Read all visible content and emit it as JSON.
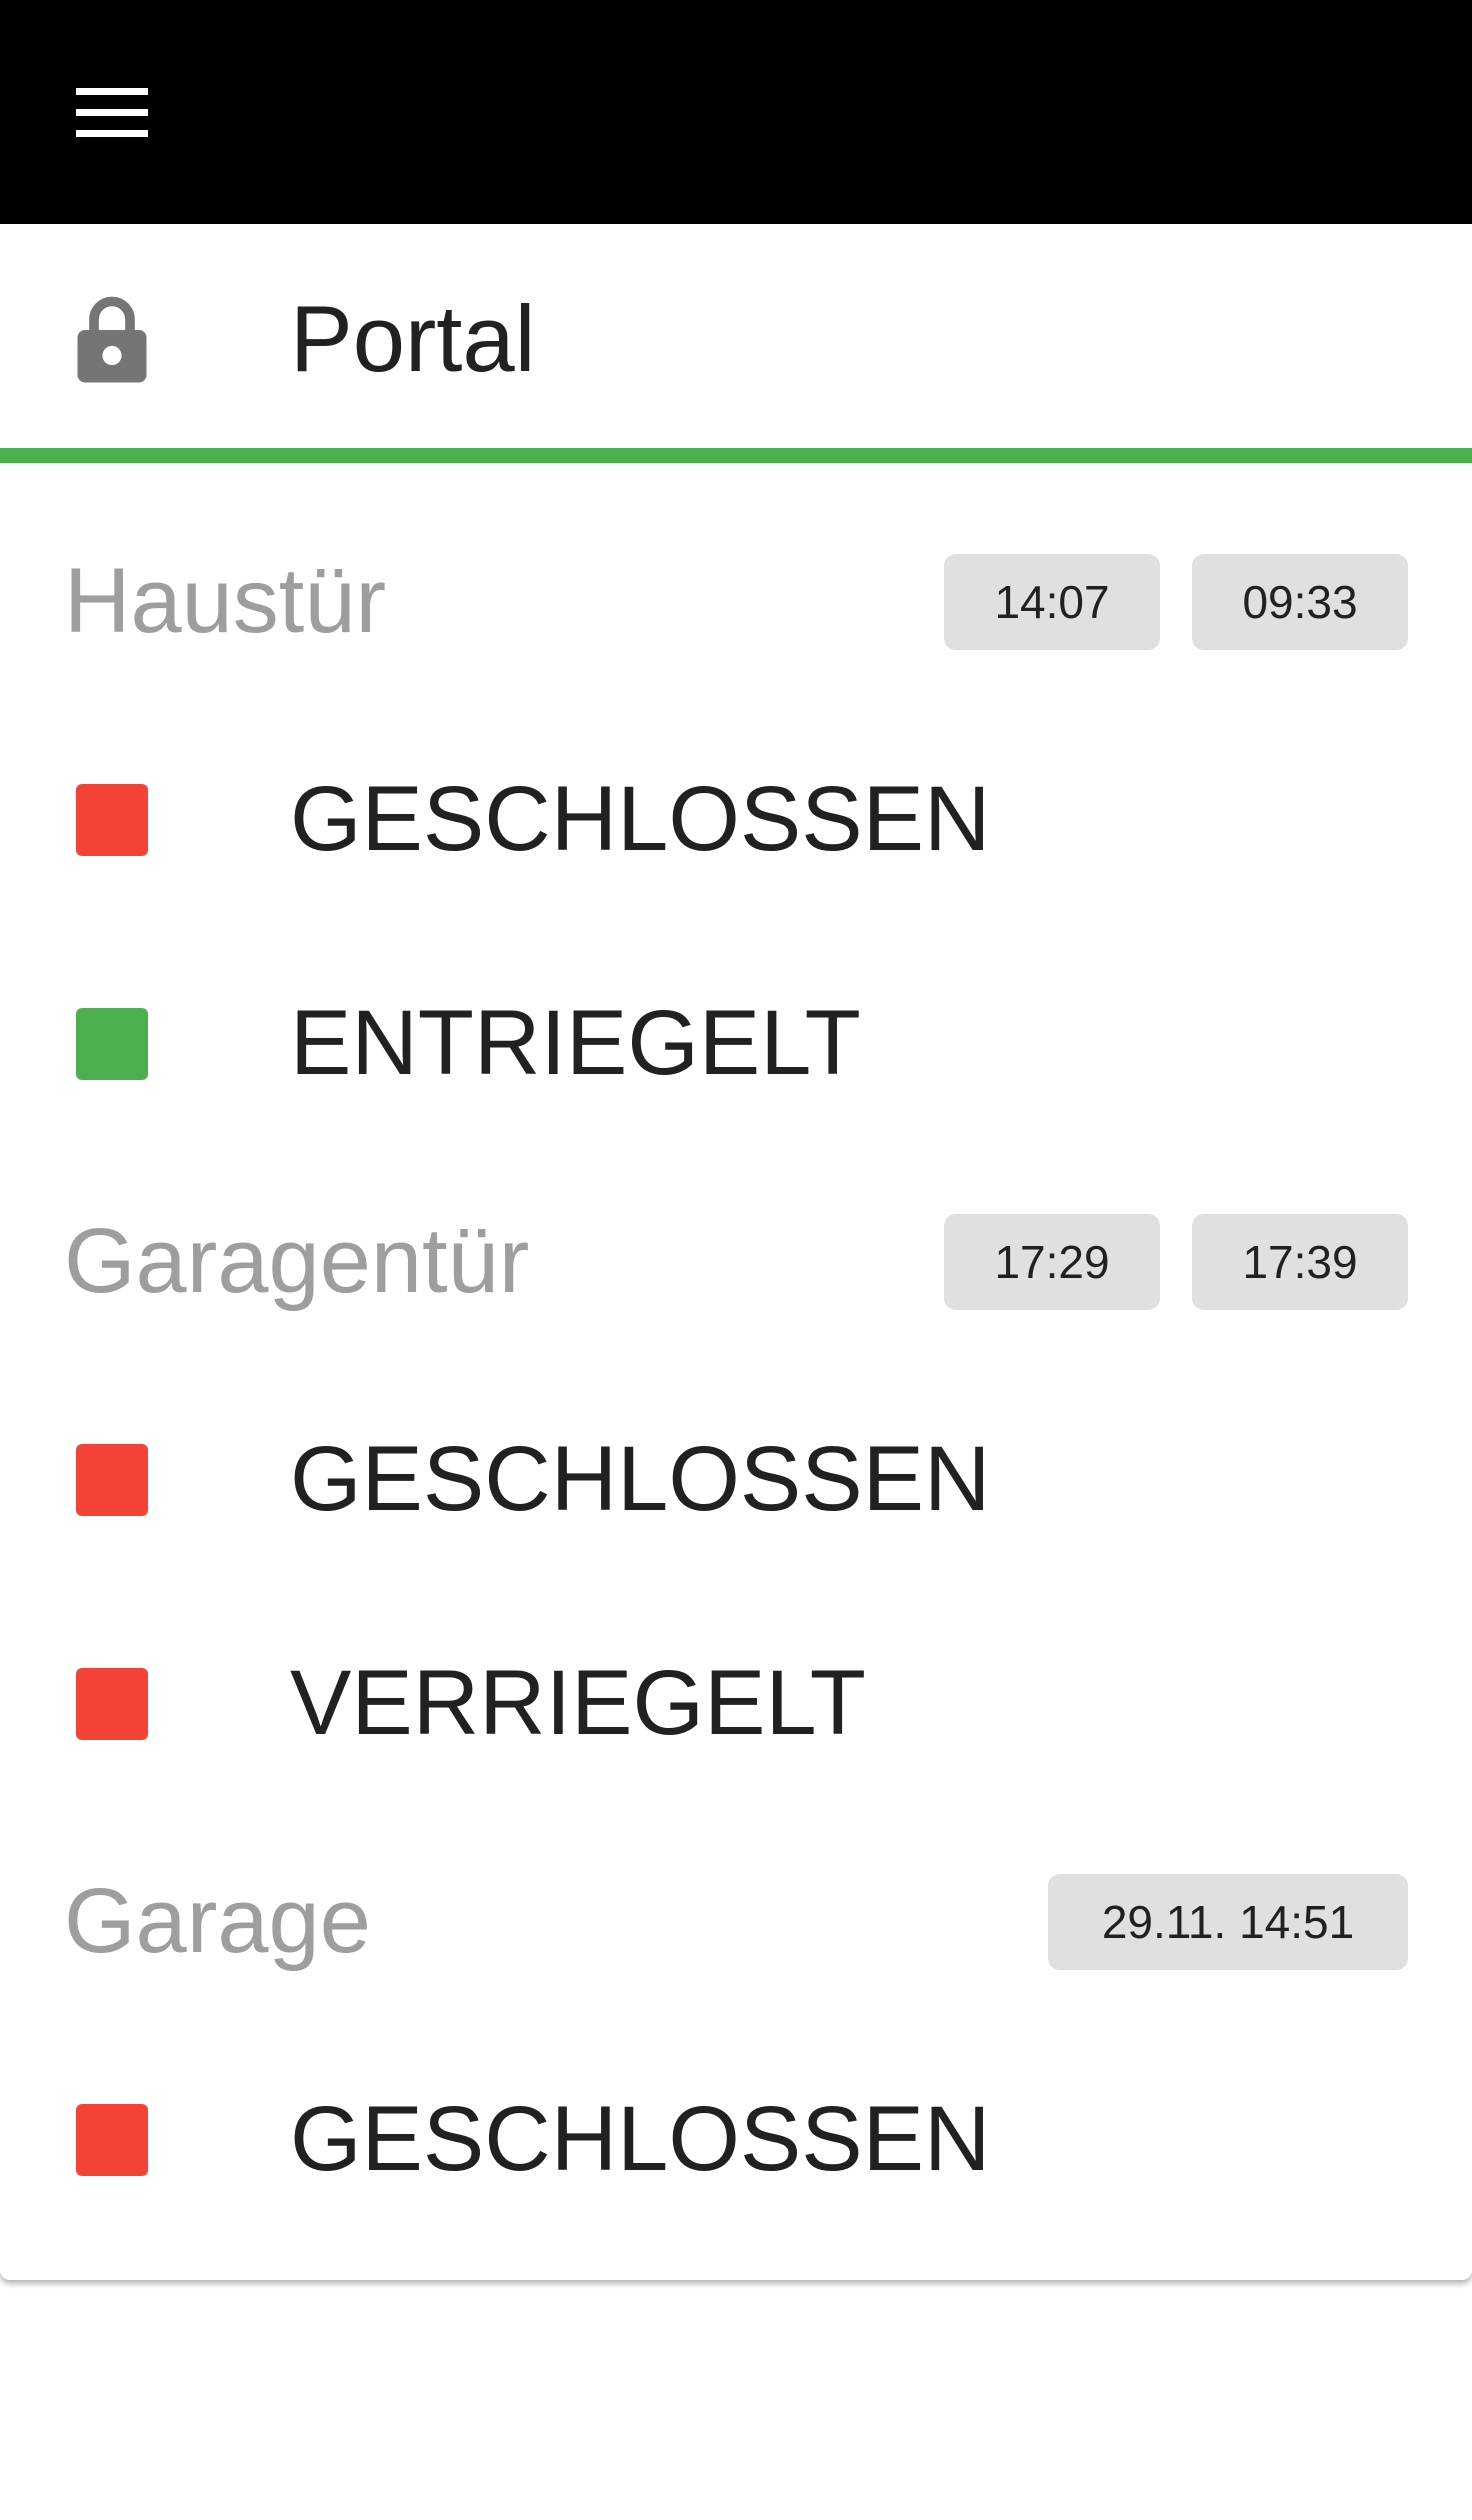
{
  "app": {
    "menu_icon": "hamburger-menu-icon"
  },
  "card": {
    "icon": "lock-icon",
    "title": "Portal",
    "accent_color": "#4caf50"
  },
  "colors": {
    "closed_or_locked": "#f44336",
    "open_or_unlocked": "#4caf50",
    "chip_background": "#e0e0e0",
    "group_title": "#9e9e9e"
  },
  "groups": [
    {
      "title": "Haustür",
      "timestamps": [
        "14:07",
        "09:33"
      ],
      "states": [
        {
          "label": "GESCHLOSSEN",
          "color": "#f44336"
        },
        {
          "label": "ENTRIEGELT",
          "color": "#4caf50"
        }
      ]
    },
    {
      "title": "Garagentür",
      "timestamps": [
        "17:29",
        "17:39"
      ],
      "states": [
        {
          "label": "GESCHLOSSEN",
          "color": "#f44336"
        },
        {
          "label": "VERRIEGELT",
          "color": "#f44336"
        }
      ]
    },
    {
      "title": "Garage",
      "timestamps": [
        "29.11. 14:51"
      ],
      "states": [
        {
          "label": "GESCHLOSSEN",
          "color": "#f44336"
        }
      ]
    }
  ]
}
